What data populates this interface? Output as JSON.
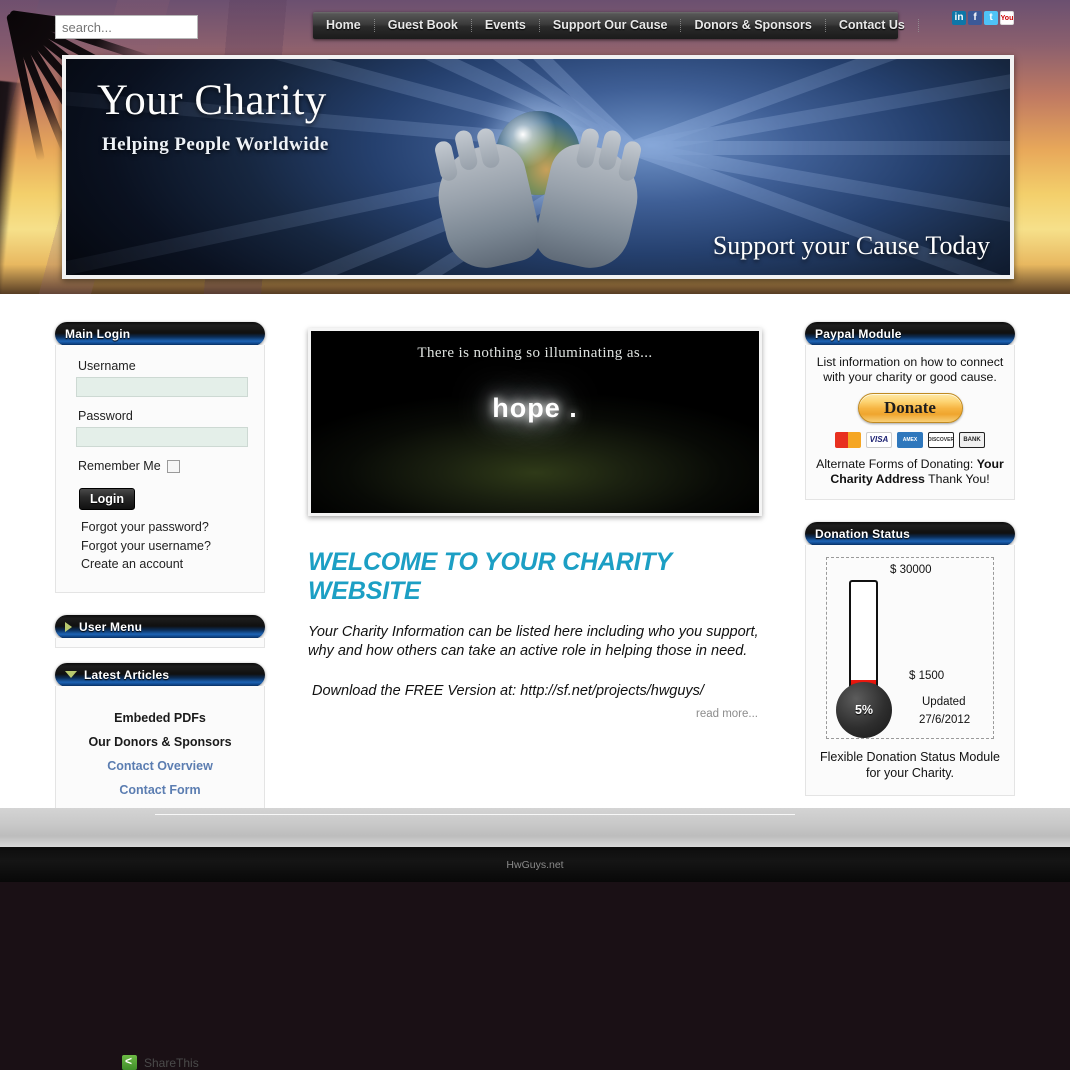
{
  "search": {
    "placeholder": "search..."
  },
  "nav": {
    "items": [
      {
        "label": "Home"
      },
      {
        "label": "Guest Book"
      },
      {
        "label": "Events"
      },
      {
        "label": "Support Our Cause"
      },
      {
        "label": "Donors & Sponsors"
      },
      {
        "label": "Contact Us"
      }
    ]
  },
  "social": {
    "items": [
      {
        "name": "linkedin-icon",
        "glyph": "in"
      },
      {
        "name": "facebook-icon",
        "glyph": "f"
      },
      {
        "name": "twitter-icon",
        "glyph": "t"
      },
      {
        "name": "youtube-icon",
        "glyph": "You"
      }
    ]
  },
  "banner": {
    "title": "Your Charity",
    "subtitle": "Helping People Worldwide",
    "tagline": "Support your Cause Today"
  },
  "login": {
    "header": "Main Login",
    "username_label": "Username",
    "username_value": "",
    "password_label": "Password",
    "password_value": "",
    "remember_label": "Remember Me",
    "button": "Login",
    "links": [
      "Forgot your password?",
      "Forgot your username?",
      "Create an account"
    ]
  },
  "user_menu": {
    "header": "User Menu"
  },
  "latest_articles": {
    "header": "Latest Articles",
    "items": [
      {
        "label": "Embeded PDFs",
        "style": "bold"
      },
      {
        "label": "Our Donors & Sponsors",
        "style": "bold"
      },
      {
        "label": "Contact Overview",
        "style": "blue"
      },
      {
        "label": "Contact Form",
        "style": "blue"
      }
    ]
  },
  "sharethis": {
    "label": "ShareThis"
  },
  "video": {
    "caption": "There is nothing so illuminating as...",
    "glow_text": "hope ."
  },
  "welcome": {
    "title": "WELCOME TO YOUR CHARITY WEBSITE",
    "paragraph": "Your Charity Information can be listed here including who you support, why and how others can take an active role in helping those in need.",
    "download_line": "Download the FREE Version at:  http://sf.net/projects/hwguys/",
    "read_more": "read more..."
  },
  "paypal": {
    "header": "Paypal Module",
    "intro": "List information on how to connect with your charity or good cause.",
    "donate_button": "Donate",
    "cards": [
      {
        "name": "mastercard-icon",
        "label": ""
      },
      {
        "name": "visa-icon",
        "label": "VISA"
      },
      {
        "name": "amex-icon",
        "label": "AMEX"
      },
      {
        "name": "discover-icon",
        "label": "DISCOVER"
      },
      {
        "name": "bank-icon",
        "label": "BANK"
      }
    ],
    "alternate_prefix": "Alternate Forms of Donating: ",
    "alternate_bold": "Your Charity Address",
    "alternate_suffix": " Thank You!"
  },
  "donation": {
    "header": "Donation Status",
    "goal": "$ 30000",
    "current": "$ 1500",
    "percent": "5%",
    "updated_label": "Updated",
    "updated_date": "27/6/2012",
    "caption": "Flexible Donation Status Module for your Charity."
  },
  "footer": {
    "text": "HwGuys.net"
  },
  "colors": {
    "accent_blue": "#1c9fc4",
    "module_blue": "#1d63b4",
    "donate_gold": "#f6b441",
    "thermo_red": "#f01a10",
    "link_blue": "#5b7db1"
  }
}
